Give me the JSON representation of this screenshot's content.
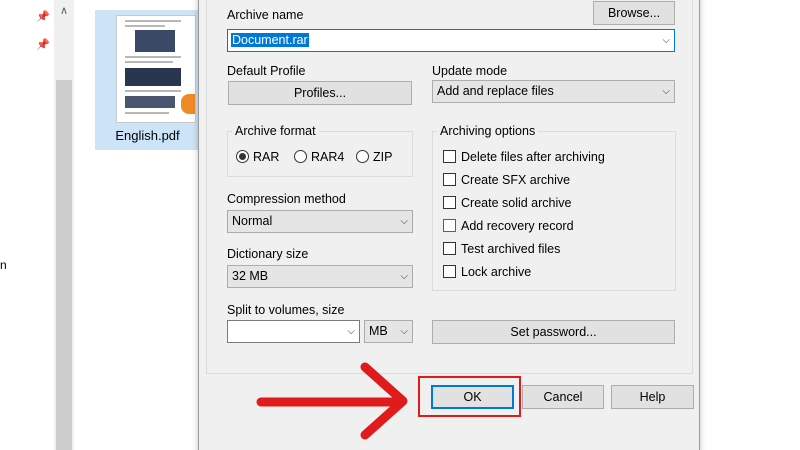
{
  "explorer": {
    "file_name": "English.pdf",
    "nav_fragment": "n"
  },
  "dialog": {
    "archive_name_label": "Archive name",
    "archive_name_value": "Document.rar",
    "browse_label": "Browse...",
    "default_profile_label": "Default Profile",
    "profiles_button": "Profiles...",
    "update_mode_label": "Update mode",
    "update_mode_value": "Add and replace files",
    "archive_format": {
      "title": "Archive format",
      "options": [
        "RAR",
        "RAR4",
        "ZIP"
      ],
      "selected": "RAR"
    },
    "archiving_options": {
      "title": "Archiving options",
      "items": [
        {
          "label": "Delete files after archiving",
          "checked": false
        },
        {
          "label": "Create SFX archive",
          "checked": false
        },
        {
          "label": "Create solid archive",
          "checked": false
        },
        {
          "label": "Add recovery record",
          "checked": false
        },
        {
          "label": "Test archived files",
          "checked": false
        },
        {
          "label": "Lock archive",
          "checked": false
        }
      ]
    },
    "compression_method_label": "Compression method",
    "compression_method_value": "Normal",
    "dictionary_size_label": "Dictionary size",
    "dictionary_size_value": "32 MB",
    "split_label": "Split to volumes, size",
    "split_value": "",
    "split_unit": "MB",
    "set_password_button": "Set password...",
    "ok_button": "OK",
    "cancel_button": "Cancel",
    "help_button": "Help"
  },
  "annotation": {
    "color": "#e01b1b"
  },
  "icons": {
    "pin": "pin-icon",
    "dropdown": "chevron-down-icon"
  }
}
